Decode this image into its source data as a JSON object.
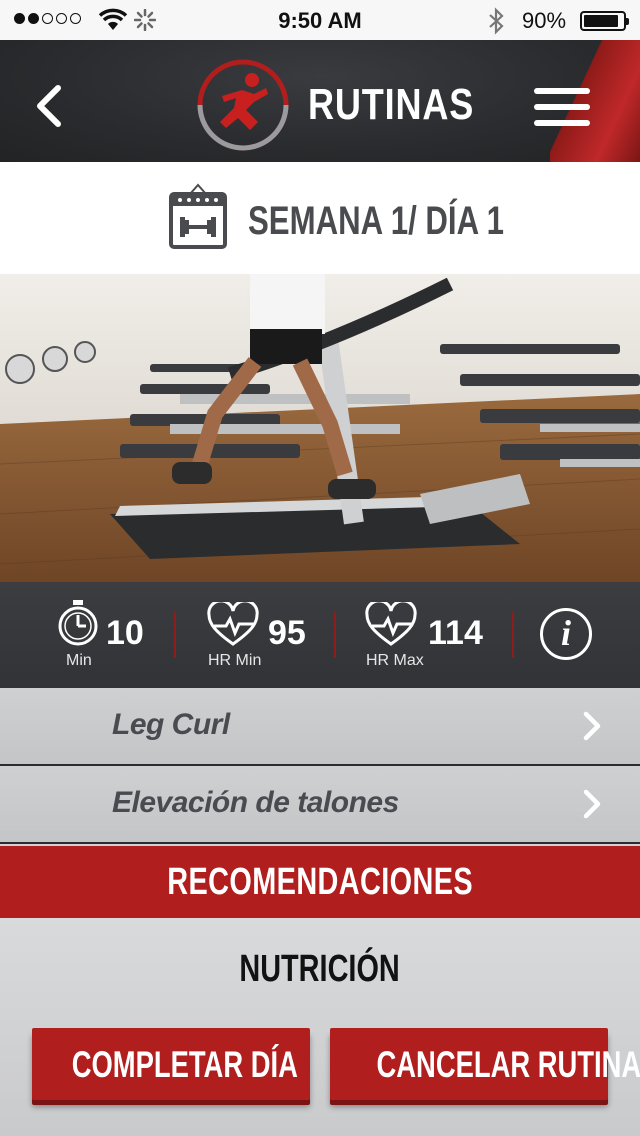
{
  "status_bar": {
    "time": "9:50 AM",
    "battery_percent": "90%",
    "battery_level": 0.9,
    "signal_bars": 2,
    "signal_total": 5
  },
  "header": {
    "title": "RUTINAS",
    "accent_color": "#b01e1d"
  },
  "week": {
    "label": "SEMANA 1/ DÍA 1"
  },
  "stats": [
    {
      "icon": "stopwatch-icon",
      "value": "10",
      "label": "Min"
    },
    {
      "icon": "heart-rate-icon",
      "value": "95",
      "label": "HR Min"
    },
    {
      "icon": "heart-rate-icon",
      "value": "114",
      "label": "HR Max"
    }
  ],
  "exercises": [
    {
      "name": "Leg Curl"
    },
    {
      "name": "Elevación de talones"
    }
  ],
  "recommendations": {
    "label": "RECOMENDACIONES"
  },
  "nutrition": {
    "label": "NUTRICIÓN"
  },
  "actions": {
    "complete": "COMPLETAR DÍA",
    "cancel": "CANCELAR RUTINA"
  }
}
